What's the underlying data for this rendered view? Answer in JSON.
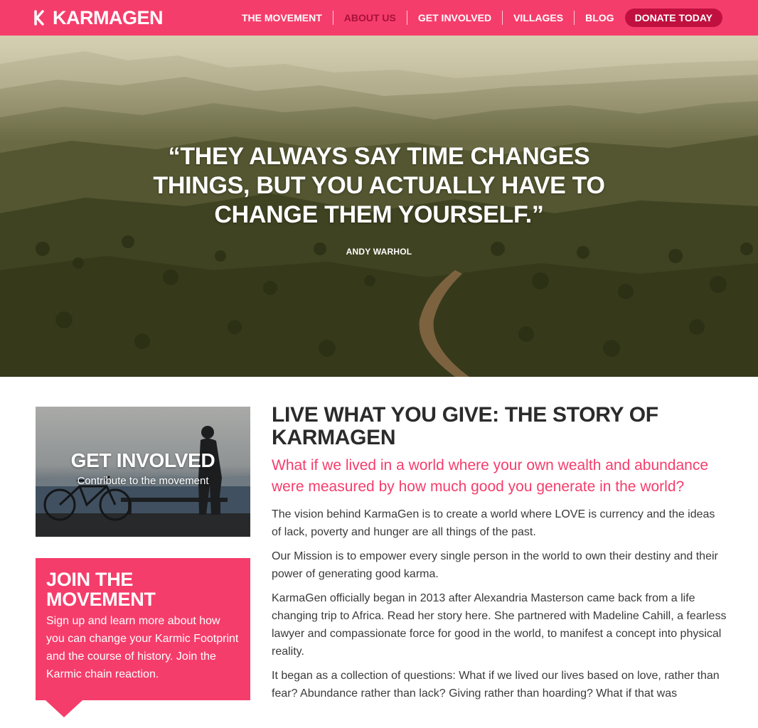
{
  "brand": {
    "name": "KARMAGEN",
    "color": "#f53d6b",
    "accent_dark": "#c0103f",
    "active_nav_color": "#a7113a"
  },
  "nav": {
    "items": [
      {
        "label": "THE MOVEMENT",
        "active": false
      },
      {
        "label": "ABOUT US",
        "active": true
      },
      {
        "label": "GET INVOLVED",
        "active": false
      },
      {
        "label": "VILLAGES",
        "active": false
      },
      {
        "label": "BLOG",
        "active": false
      }
    ],
    "donate_label": "DONATE TODAY"
  },
  "hero": {
    "quote": "“They always say time changes things, but you actually have to change them yourself.”",
    "author": "Andy Warhol"
  },
  "sidebar": {
    "involved": {
      "title": "GET INVOLVED",
      "subtitle": "Contribute to the movement"
    },
    "join": {
      "title": "JOIN THE MOVEMENT",
      "body": "Sign up and learn more about how you can change your Karmic Footprint and the course of history. Join the Karmic chain reaction."
    }
  },
  "main": {
    "heading": "LIVE WHAT YOU GIVE: THE STORY OF KARMAGEN",
    "lead": "What if we lived in a world where your own wealth and abundance were measured by how much good you generate in the world?",
    "paragraphs": [
      "The vision behind KarmaGen is to create a world where LOVE is currency and the ideas of lack, poverty and hunger are all things of the past.",
      "Our Mission is to empower every single person in the world to own their destiny and their power of generating good karma.",
      "KarmaGen officially began in 2013 after Alexandria Masterson came back from a life changing trip to Africa. Read her story here. She partnered with Madeline Cahill, a fearless lawyer and compassionate force for good in the world, to manifest a concept into physical reality.",
      "It began as a collection of questions: What if we lived our lives based on love, rather than fear? Abundance rather than lack? Giving rather than hoarding? What if that was"
    ]
  }
}
